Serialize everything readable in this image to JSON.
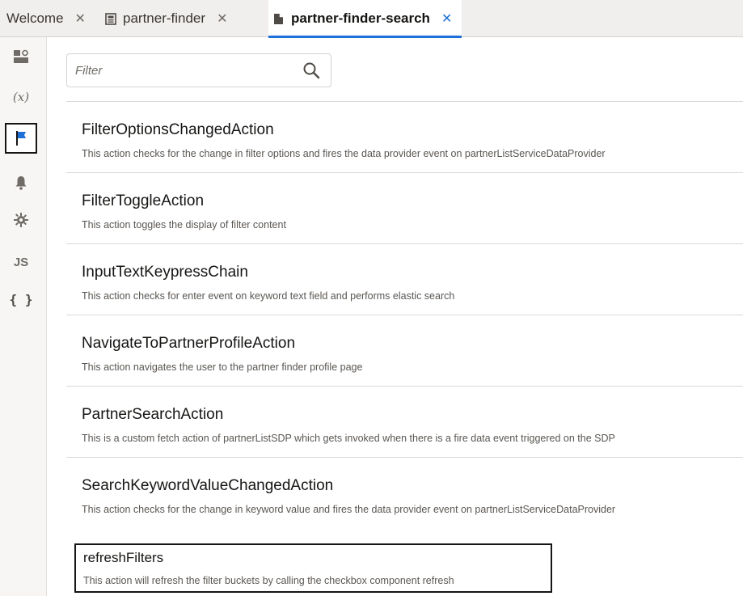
{
  "tabs": [
    {
      "label": "Welcome",
      "close": "✕",
      "icon": "",
      "active": false
    },
    {
      "label": "partner-finder",
      "close": "✕",
      "icon": "page-icon",
      "active": false
    },
    {
      "label": "partner-finder-search",
      "close": "✕",
      "icon": "document-icon",
      "active": true
    }
  ],
  "rail": {
    "items": [
      {
        "name": "page-designer-icon",
        "text": ""
      },
      {
        "name": "variables-icon",
        "text": "(x)"
      },
      {
        "name": "actions-flag-icon",
        "text": ""
      },
      {
        "name": "events-bell-icon",
        "text": ""
      },
      {
        "name": "settings-gear-icon",
        "text": ""
      },
      {
        "name": "javascript-icon",
        "text": "JS"
      },
      {
        "name": "json-icon",
        "text": "{ }"
      }
    ],
    "selected_index": 2
  },
  "filter": {
    "placeholder": "Filter",
    "value": ""
  },
  "actions": [
    {
      "title": "FilterOptionsChangedAction",
      "description": "This action checks for the change in filter options and fires the data provider event on partnerListServiceDataProvider"
    },
    {
      "title": "FilterToggleAction",
      "description": "This action toggles the display of filter content"
    },
    {
      "title": "InputTextKeypressChain",
      "description": "This action checks for enter event on keyword text field and performs elastic search"
    },
    {
      "title": "NavigateToPartnerProfileAction",
      "description": "This action navigates the user to the partner finder profile page"
    },
    {
      "title": "PartnerSearchAction",
      "description": "This is a custom fetch action of partnerListSDP which gets invoked when there is a fire data event triggered on the SDP"
    },
    {
      "title": "SearchKeywordValueChangedAction",
      "description": "This action checks for the change in keyword value and fires the data provider event on partnerListServiceDataProvider"
    },
    {
      "title": "refreshFilters",
      "description": "This action will refresh the filter buckets by calling the checkbox component refresh"
    }
  ],
  "colors": {
    "accent": "#1f6fd8",
    "flag": "#1f6fd8",
    "text": "#161513",
    "muted": "#5a5652"
  }
}
